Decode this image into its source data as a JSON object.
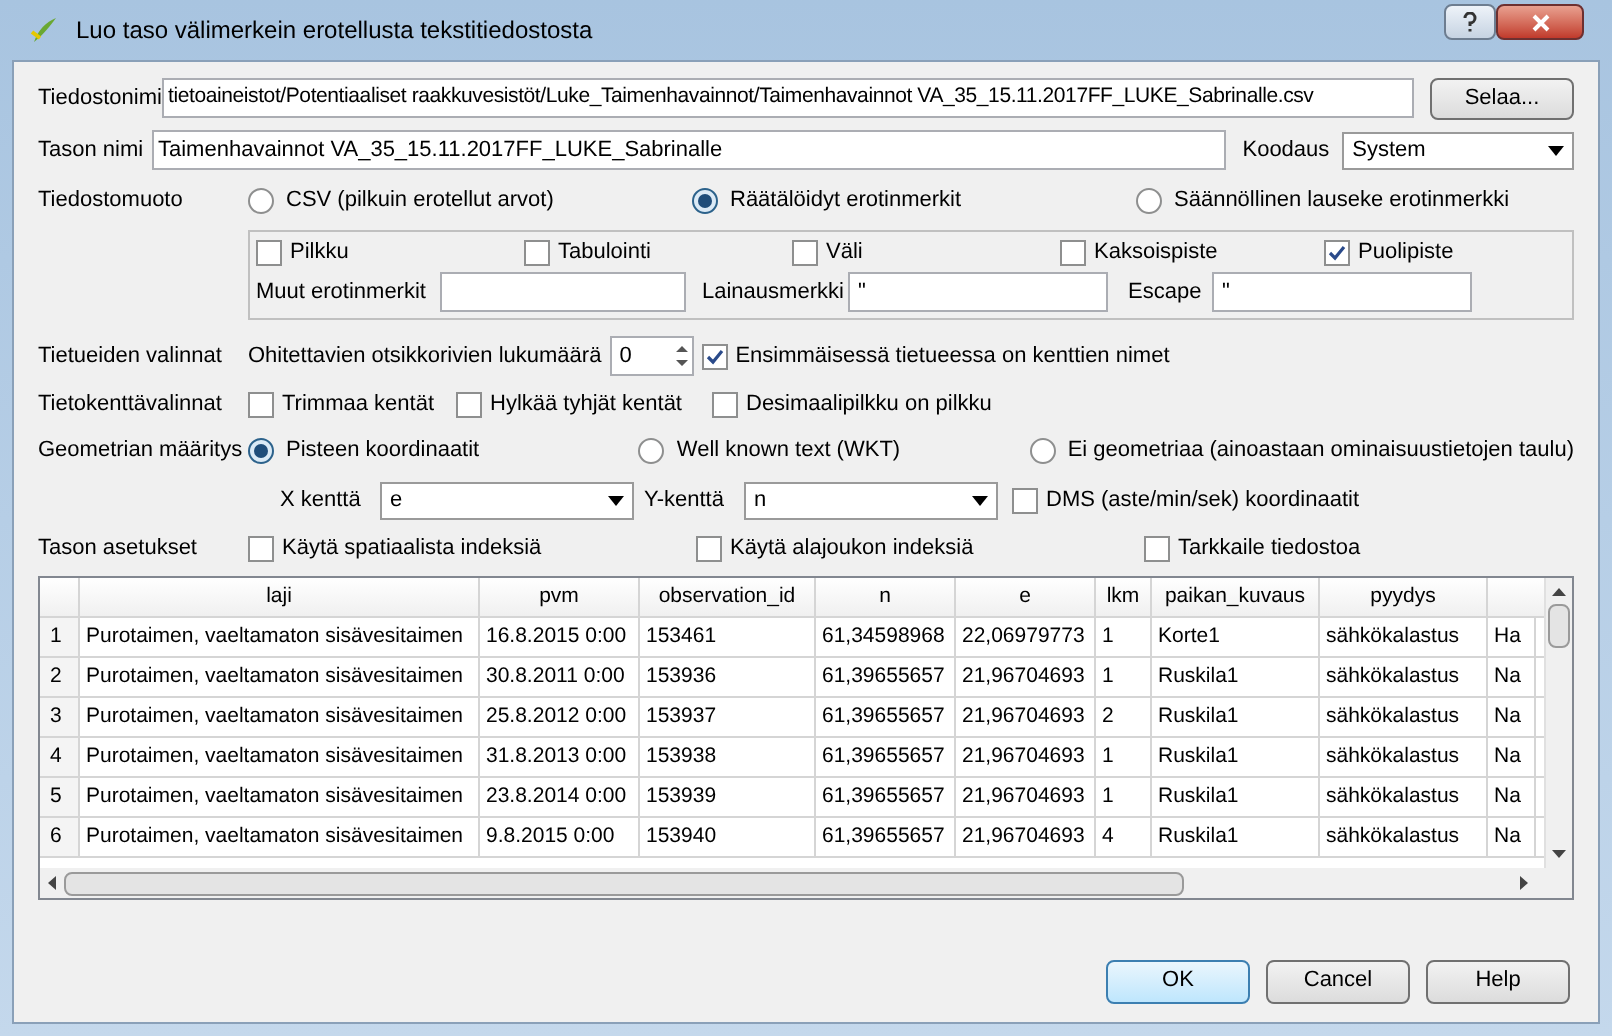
{
  "window": {
    "title": "Luo taso välimerkein erotellusta tekstitiedostosta"
  },
  "file": {
    "label": "Tiedostonimi",
    "value": "tietoaineistot/Potentiaaliset raakkuvesistöt/Luke_Taimenhavainnot/Taimenhavainnot VA_35_15.11.2017FF_LUKE_Sabrinalle.csv",
    "browse": "Selaa..."
  },
  "layer_name": {
    "label": "Tason nimi",
    "value": "Taimenhavainnot VA_35_15.11.2017FF_LUKE_Sabrinalle"
  },
  "encoding": {
    "label": "Koodaus",
    "value": "System"
  },
  "file_format": {
    "label": "Tiedostomuoto",
    "options": [
      {
        "label": "CSV (pilkuin erotellut arvot)",
        "selected": false
      },
      {
        "label": "Räätälöidyt erotinmerkit",
        "selected": true
      },
      {
        "label": "Säännöllinen lauseke erotinmerkki",
        "selected": false
      }
    ]
  },
  "delimiters": {
    "checkboxes": [
      {
        "label": "Pilkku",
        "checked": false
      },
      {
        "label": "Tabulointi",
        "checked": false
      },
      {
        "label": "Väli",
        "checked": false
      },
      {
        "label": "Kaksoispiste",
        "checked": false
      },
      {
        "label": "Puolipiste",
        "checked": true
      }
    ],
    "other": {
      "label": "Muut erotinmerkit"
    },
    "quote": {
      "label": "Lainausmerkki",
      "value": "\""
    },
    "escape": {
      "label": "Escape",
      "value": "\""
    }
  },
  "record_options": {
    "label": "Tietueiden valinnat",
    "skip_label": "Ohitettavien otsikkorivien lukumäärä",
    "skip_value": "0",
    "first_record": {
      "label": "Ensimmäisessä tietueessa on kenttien nimet",
      "checked": true
    }
  },
  "field_options": {
    "label": "Tietokenttävalinnat",
    "checkboxes": [
      {
        "label": "Trimmaa kentät",
        "checked": false
      },
      {
        "label": "Hylkää tyhjät kentät",
        "checked": false
      },
      {
        "label": "Desimaalipilkku on pilkku",
        "checked": false
      }
    ]
  },
  "geometry": {
    "label": "Geometrian määritys",
    "options": [
      {
        "label": "Pisteen koordinaatit",
        "selected": true
      },
      {
        "label": "Well known text (WKT)",
        "selected": false
      },
      {
        "label": "Ei geometriaa (ainoastaan ominaisuustietojen taulu)",
        "selected": false
      }
    ],
    "x_label": "X kenttä",
    "x_value": "e",
    "y_label": "Y-kenttä",
    "y_value": "n",
    "dms": {
      "label": "DMS (aste/min/sek) koordinaatit",
      "checked": false
    }
  },
  "layer_settings": {
    "label": "Tason asetukset",
    "checkboxes": [
      {
        "label": "Käytä spatiaalista indeksiä",
        "checked": false
      },
      {
        "label": "Käytä alajoukon indeksiä",
        "checked": false
      },
      {
        "label": "Tarkkaile tiedostoa",
        "checked": false
      }
    ]
  },
  "table": {
    "columns": [
      "laji",
      "pvm",
      "observation_id",
      "n",
      "e",
      "lkm",
      "paikan_kuvaus",
      "pyydys"
    ],
    "rows": [
      {
        "number": "1",
        "cells": [
          "Purotaimen, vaeltamaton sisävesitaimen",
          "16.8.2015 0:00",
          "153461",
          "61,34598968",
          "22,06979773",
          "1",
          "Korte1",
          "sähkökalastus",
          "Ha"
        ]
      },
      {
        "number": "2",
        "cells": [
          "Purotaimen, vaeltamaton sisävesitaimen",
          "30.8.2011 0:00",
          "153936",
          "61,39655657",
          "21,96704693",
          "1",
          "Ruskila1",
          "sähkökalastus",
          "Na"
        ]
      },
      {
        "number": "3",
        "cells": [
          "Purotaimen, vaeltamaton sisävesitaimen",
          "25.8.2012 0:00",
          "153937",
          "61,39655657",
          "21,96704693",
          "2",
          "Ruskila1",
          "sähkökalastus",
          "Na"
        ]
      },
      {
        "number": "4",
        "cells": [
          "Purotaimen, vaeltamaton sisävesitaimen",
          "31.8.2013 0:00",
          "153938",
          "61,39655657",
          "21,96704693",
          "1",
          "Ruskila1",
          "sähkökalastus",
          "Na"
        ]
      },
      {
        "number": "5",
        "cells": [
          "Purotaimen, vaeltamaton sisävesitaimen",
          "23.8.2014 0:00",
          "153939",
          "61,39655657",
          "21,96704693",
          "1",
          "Ruskila1",
          "sähkökalastus",
          "Na"
        ]
      },
      {
        "number": "6",
        "cells": [
          "Purotaimen, vaeltamaton sisävesitaimen",
          "9.8.2015 0:00",
          "153940",
          "61,39655657",
          "21,96704693",
          "4",
          "Ruskila1",
          "sähkökalastus",
          "Na"
        ]
      }
    ]
  },
  "buttons": [
    {
      "label": "OK",
      "default": true
    },
    {
      "label": "Cancel",
      "default": false
    },
    {
      "label": "Help",
      "default": false
    }
  ]
}
